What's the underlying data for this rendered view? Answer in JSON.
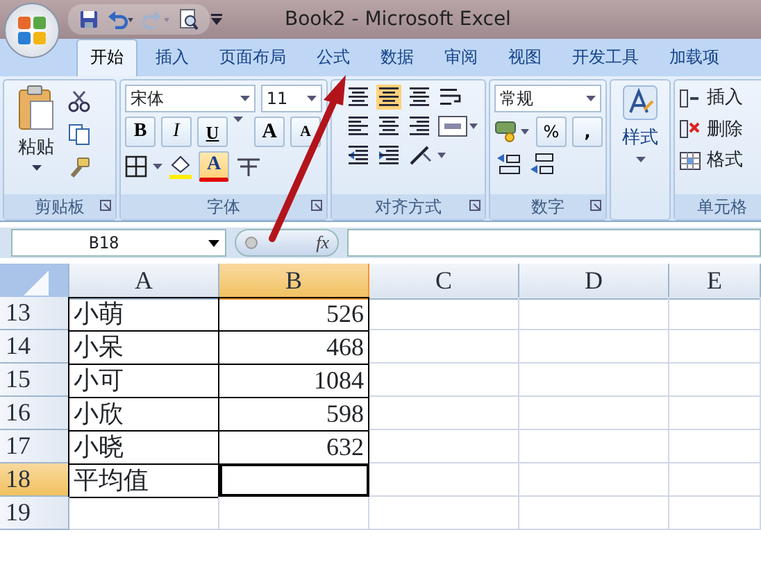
{
  "window": {
    "title": "Book2 - Microsoft Excel"
  },
  "tabs": [
    {
      "label": "开始",
      "selected": true
    },
    {
      "label": "插入",
      "selected": false
    },
    {
      "label": "页面布局",
      "selected": false
    },
    {
      "label": "公式",
      "selected": false
    },
    {
      "label": "数据",
      "selected": false
    },
    {
      "label": "审阅",
      "selected": false
    },
    {
      "label": "视图",
      "selected": false
    },
    {
      "label": "开发工具",
      "selected": false
    },
    {
      "label": "加载项",
      "selected": false
    }
  ],
  "ribbon": {
    "clipboard": {
      "label": "剪贴板",
      "paste": "粘贴"
    },
    "font": {
      "label": "字体",
      "font_name": "宋体",
      "font_size": "11",
      "bold": "B",
      "italic": "I",
      "underline": "U",
      "grow": "A",
      "shrink": "A",
      "font_color": "A"
    },
    "alignment": {
      "label": "对齐方式"
    },
    "number": {
      "label": "数字",
      "format": "常规",
      "percent": "%",
      "comma": ","
    },
    "styles": {
      "button": "样式"
    },
    "cells": {
      "label": "单元格",
      "buttons": [
        "插入",
        "删除",
        "格式"
      ]
    }
  },
  "formula_bar": {
    "name_box": "B18",
    "fx": "fx"
  },
  "columns": [
    {
      "label": "A",
      "selected": false
    },
    {
      "label": "B",
      "selected": true
    },
    {
      "label": "C",
      "selected": false
    },
    {
      "label": "D",
      "selected": false
    },
    {
      "label": "E",
      "selected": false
    }
  ],
  "rows": [
    {
      "number": "13",
      "name": "小萌",
      "value": "526",
      "selected": false
    },
    {
      "number": "14",
      "name": "小呆",
      "value": "468",
      "selected": false
    },
    {
      "number": "15",
      "name": "小可",
      "value": "1084",
      "selected": false
    },
    {
      "number": "16",
      "name": "小欣",
      "value": "598",
      "selected": false
    },
    {
      "number": "17",
      "name": "小晓",
      "value": "632",
      "selected": false
    },
    {
      "number": "18",
      "name": "平均值",
      "selected": true
    },
    {
      "number": "19",
      "selected": false
    }
  ]
}
